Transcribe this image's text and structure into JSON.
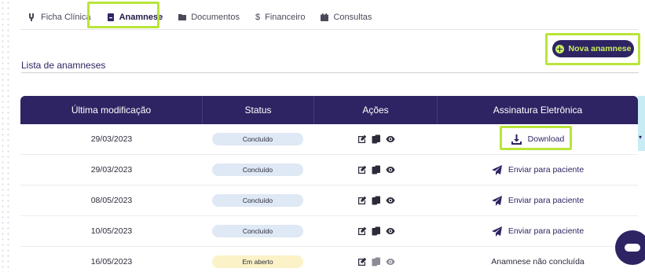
{
  "tabs": [
    {
      "label": "Ficha Clínica",
      "icon": "clinic-icon"
    },
    {
      "label": "Anamnese",
      "icon": "notebook-icon"
    },
    {
      "label": "Documentos",
      "icon": "folder-icon"
    },
    {
      "label": "Financeiro",
      "icon": "dollar-icon"
    },
    {
      "label": "Consultas",
      "icon": "calendar-icon"
    }
  ],
  "section": {
    "title": "Lista de anamneses"
  },
  "new_button": {
    "label": "Nova anamnese"
  },
  "table": {
    "headers": [
      "Última modificação",
      "Status",
      "Ações",
      "Assinatura Eletrônica"
    ],
    "rows": [
      {
        "date": "29/03/2023",
        "status": "Concluído",
        "signature": "Download",
        "signature_type": "download"
      },
      {
        "date": "29/03/2023",
        "status": "Concluído",
        "signature": "Enviar para paciente",
        "signature_type": "send"
      },
      {
        "date": "08/05/2023",
        "status": "Concluído",
        "signature": "Enviar para paciente",
        "signature_type": "send"
      },
      {
        "date": "10/05/2023",
        "status": "Concluído",
        "signature": "Enviar para paciente",
        "signature_type": "send"
      },
      {
        "date": "16/05/2023",
        "status": "Em aberto",
        "signature": "Anamnese não concluída",
        "signature_type": "text"
      }
    ]
  },
  "colors": {
    "primary": "#2e2463",
    "accent": "#c9ee5b",
    "highlight": "#b9e53a",
    "badge_done": "#dfe8f5",
    "badge_open": "#fbf2c7"
  }
}
